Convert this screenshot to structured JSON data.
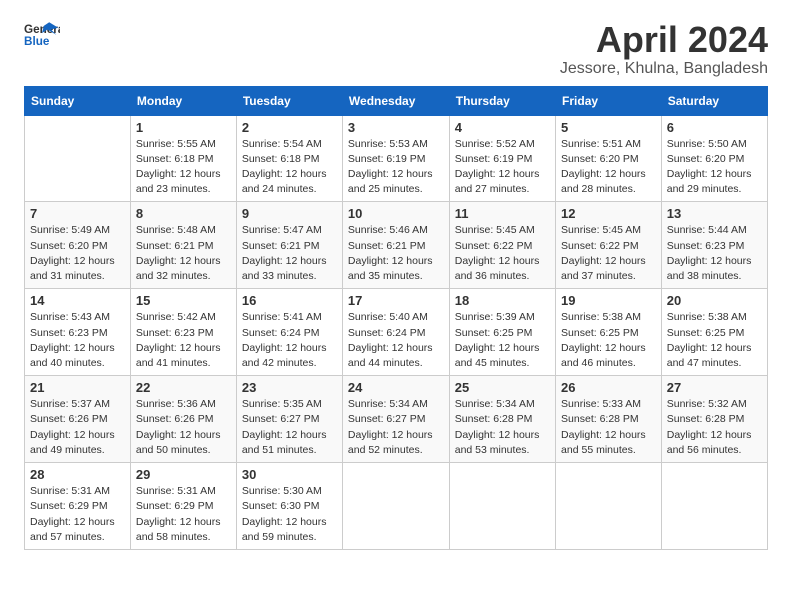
{
  "header": {
    "logo_general": "General",
    "logo_blue": "Blue",
    "month_title": "April 2024",
    "location": "Jessore, Khulna, Bangladesh"
  },
  "columns": [
    "Sunday",
    "Monday",
    "Tuesday",
    "Wednesday",
    "Thursday",
    "Friday",
    "Saturday"
  ],
  "weeks": [
    [
      {
        "day": "",
        "sunrise": "",
        "sunset": "",
        "daylight": ""
      },
      {
        "day": "1",
        "sunrise": "Sunrise: 5:55 AM",
        "sunset": "Sunset: 6:18 PM",
        "daylight": "Daylight: 12 hours and 23 minutes."
      },
      {
        "day": "2",
        "sunrise": "Sunrise: 5:54 AM",
        "sunset": "Sunset: 6:18 PM",
        "daylight": "Daylight: 12 hours and 24 minutes."
      },
      {
        "day": "3",
        "sunrise": "Sunrise: 5:53 AM",
        "sunset": "Sunset: 6:19 PM",
        "daylight": "Daylight: 12 hours and 25 minutes."
      },
      {
        "day": "4",
        "sunrise": "Sunrise: 5:52 AM",
        "sunset": "Sunset: 6:19 PM",
        "daylight": "Daylight: 12 hours and 27 minutes."
      },
      {
        "day": "5",
        "sunrise": "Sunrise: 5:51 AM",
        "sunset": "Sunset: 6:20 PM",
        "daylight": "Daylight: 12 hours and 28 minutes."
      },
      {
        "day": "6",
        "sunrise": "Sunrise: 5:50 AM",
        "sunset": "Sunset: 6:20 PM",
        "daylight": "Daylight: 12 hours and 29 minutes."
      }
    ],
    [
      {
        "day": "7",
        "sunrise": "Sunrise: 5:49 AM",
        "sunset": "Sunset: 6:20 PM",
        "daylight": "Daylight: 12 hours and 31 minutes."
      },
      {
        "day": "8",
        "sunrise": "Sunrise: 5:48 AM",
        "sunset": "Sunset: 6:21 PM",
        "daylight": "Daylight: 12 hours and 32 minutes."
      },
      {
        "day": "9",
        "sunrise": "Sunrise: 5:47 AM",
        "sunset": "Sunset: 6:21 PM",
        "daylight": "Daylight: 12 hours and 33 minutes."
      },
      {
        "day": "10",
        "sunrise": "Sunrise: 5:46 AM",
        "sunset": "Sunset: 6:21 PM",
        "daylight": "Daylight: 12 hours and 35 minutes."
      },
      {
        "day": "11",
        "sunrise": "Sunrise: 5:45 AM",
        "sunset": "Sunset: 6:22 PM",
        "daylight": "Daylight: 12 hours and 36 minutes."
      },
      {
        "day": "12",
        "sunrise": "Sunrise: 5:45 AM",
        "sunset": "Sunset: 6:22 PM",
        "daylight": "Daylight: 12 hours and 37 minutes."
      },
      {
        "day": "13",
        "sunrise": "Sunrise: 5:44 AM",
        "sunset": "Sunset: 6:23 PM",
        "daylight": "Daylight: 12 hours and 38 minutes."
      }
    ],
    [
      {
        "day": "14",
        "sunrise": "Sunrise: 5:43 AM",
        "sunset": "Sunset: 6:23 PM",
        "daylight": "Daylight: 12 hours and 40 minutes."
      },
      {
        "day": "15",
        "sunrise": "Sunrise: 5:42 AM",
        "sunset": "Sunset: 6:23 PM",
        "daylight": "Daylight: 12 hours and 41 minutes."
      },
      {
        "day": "16",
        "sunrise": "Sunrise: 5:41 AM",
        "sunset": "Sunset: 6:24 PM",
        "daylight": "Daylight: 12 hours and 42 minutes."
      },
      {
        "day": "17",
        "sunrise": "Sunrise: 5:40 AM",
        "sunset": "Sunset: 6:24 PM",
        "daylight": "Daylight: 12 hours and 44 minutes."
      },
      {
        "day": "18",
        "sunrise": "Sunrise: 5:39 AM",
        "sunset": "Sunset: 6:25 PM",
        "daylight": "Daylight: 12 hours and 45 minutes."
      },
      {
        "day": "19",
        "sunrise": "Sunrise: 5:38 AM",
        "sunset": "Sunset: 6:25 PM",
        "daylight": "Daylight: 12 hours and 46 minutes."
      },
      {
        "day": "20",
        "sunrise": "Sunrise: 5:38 AM",
        "sunset": "Sunset: 6:25 PM",
        "daylight": "Daylight: 12 hours and 47 minutes."
      }
    ],
    [
      {
        "day": "21",
        "sunrise": "Sunrise: 5:37 AM",
        "sunset": "Sunset: 6:26 PM",
        "daylight": "Daylight: 12 hours and 49 minutes."
      },
      {
        "day": "22",
        "sunrise": "Sunrise: 5:36 AM",
        "sunset": "Sunset: 6:26 PM",
        "daylight": "Daylight: 12 hours and 50 minutes."
      },
      {
        "day": "23",
        "sunrise": "Sunrise: 5:35 AM",
        "sunset": "Sunset: 6:27 PM",
        "daylight": "Daylight: 12 hours and 51 minutes."
      },
      {
        "day": "24",
        "sunrise": "Sunrise: 5:34 AM",
        "sunset": "Sunset: 6:27 PM",
        "daylight": "Daylight: 12 hours and 52 minutes."
      },
      {
        "day": "25",
        "sunrise": "Sunrise: 5:34 AM",
        "sunset": "Sunset: 6:28 PM",
        "daylight": "Daylight: 12 hours and 53 minutes."
      },
      {
        "day": "26",
        "sunrise": "Sunrise: 5:33 AM",
        "sunset": "Sunset: 6:28 PM",
        "daylight": "Daylight: 12 hours and 55 minutes."
      },
      {
        "day": "27",
        "sunrise": "Sunrise: 5:32 AM",
        "sunset": "Sunset: 6:28 PM",
        "daylight": "Daylight: 12 hours and 56 minutes."
      }
    ],
    [
      {
        "day": "28",
        "sunrise": "Sunrise: 5:31 AM",
        "sunset": "Sunset: 6:29 PM",
        "daylight": "Daylight: 12 hours and 57 minutes."
      },
      {
        "day": "29",
        "sunrise": "Sunrise: 5:31 AM",
        "sunset": "Sunset: 6:29 PM",
        "daylight": "Daylight: 12 hours and 58 minutes."
      },
      {
        "day": "30",
        "sunrise": "Sunrise: 5:30 AM",
        "sunset": "Sunset: 6:30 PM",
        "daylight": "Daylight: 12 hours and 59 minutes."
      },
      {
        "day": "",
        "sunrise": "",
        "sunset": "",
        "daylight": ""
      },
      {
        "day": "",
        "sunrise": "",
        "sunset": "",
        "daylight": ""
      },
      {
        "day": "",
        "sunrise": "",
        "sunset": "",
        "daylight": ""
      },
      {
        "day": "",
        "sunrise": "",
        "sunset": "",
        "daylight": ""
      }
    ]
  ]
}
